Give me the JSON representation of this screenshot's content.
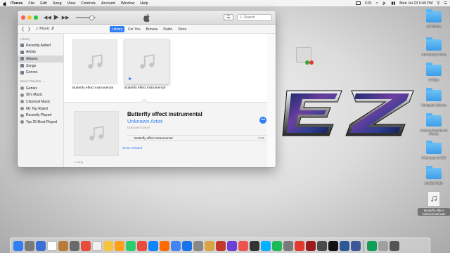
{
  "menubar": {
    "app_name": "iTunes",
    "menus": [
      "File",
      "Edit",
      "Song",
      "View",
      "Controls",
      "Account",
      "Window",
      "Help"
    ],
    "status_time_short": "3:31",
    "clock": "Mon Jul 23  6:49 PM"
  },
  "window": {
    "media_kind": "Music",
    "tabs": [
      "Library",
      "For You",
      "Browse",
      "Radio",
      "Store"
    ],
    "active_tab": "Library",
    "search_placeholder": "Search"
  },
  "sidebar": {
    "library_header": "Library",
    "library_items": [
      "Recently Added",
      "Artists",
      "Albums",
      "Songs",
      "Genres"
    ],
    "selected_item": "Albums",
    "playlists_header": "Music Playlists ⌄",
    "playlist_items": [
      "Genius",
      "90's Music",
      "Classical Music",
      "My Top Rated",
      "Recently Played",
      "Top 25 Most Played"
    ]
  },
  "albums": [
    {
      "title": "Butterfly effect instrumental"
    },
    {
      "title": "Butterfly effect instrumental"
    }
  ],
  "detail": {
    "title": "Butterfly effect instrumental",
    "artist": "Unknown Artist",
    "genre": "Unknown Genre",
    "more_label": "•••",
    "track_name": "Butterfly effect instrumental",
    "track_time": "0:30",
    "show_related": "Show Related",
    "song_count": "1 song"
  },
  "desktop_items": [
    {
      "label": "All Folders",
      "kind": "folder"
    },
    {
      "label": "Anniversary Video",
      "kind": "folder"
    },
    {
      "label": "College",
      "kind": "folder"
    },
    {
      "label": "Computer Science",
      "kind": "folder"
    },
    {
      "label": "Custom ringtone on iPhone",
      "kind": "folder"
    },
    {
      "label": "Hide Apps on iOS",
      "kind": "folder"
    },
    {
      "label": "untitled folder",
      "kind": "folder"
    },
    {
      "label": "Butterfly effect instrumental.wav",
      "kind": "file"
    }
  ],
  "art_text": "EZ",
  "dock_colors": [
    "#2f7ef6",
    "#7a7a7a",
    "#3b6fd6",
    "#ffffff",
    "#b97a3a",
    "#6a6a6a",
    "#e74c3c",
    "#f0f0f0",
    "#f5c542",
    "#ff9f1a",
    "#2ecc71",
    "#e74c3c",
    "#0a84ff",
    "#ff6b00",
    "#4285f4",
    "#1a73e8",
    "#888888",
    "#d9a441",
    "#c0392b",
    "#6c3fd6",
    "#ef5350",
    "#333333",
    "#00b1ff",
    "#1db954",
    "#7a7a7a",
    "#e03b2f",
    "#9b1c1c",
    "#4a4a4a",
    "#111111",
    "#2b5797",
    "#3b5998",
    "#0f9d58",
    "#a0a0a0",
    "#555555"
  ]
}
